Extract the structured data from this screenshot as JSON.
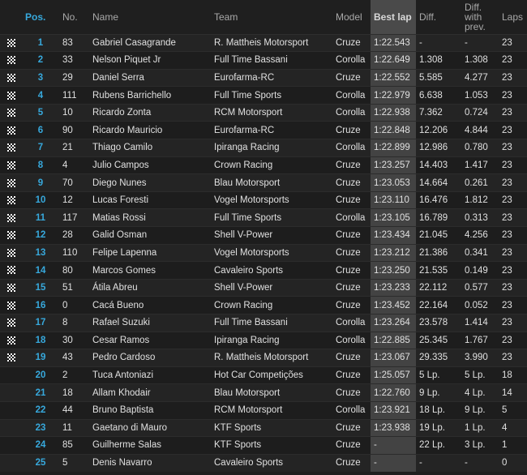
{
  "headers": {
    "pos": "Pos.",
    "no": "No.",
    "name": "Name",
    "team": "Team",
    "model": "Model",
    "best_lap": "Best lap",
    "diff": "Diff.",
    "diff_prev": "Diff. with prev.",
    "laps": "Laps"
  },
  "rows": [
    {
      "finished": true,
      "pos": "1",
      "no": "83",
      "name": "Gabriel Casagrande",
      "team": "R. Mattheis Motorsport",
      "model": "Cruze",
      "best": "1:22.543",
      "diff": "-",
      "prev": "-",
      "laps": "23"
    },
    {
      "finished": true,
      "pos": "2",
      "no": "33",
      "name": "Nelson Piquet Jr",
      "team": "Full Time Bassani",
      "model": "Corolla",
      "best": "1:22.649",
      "diff": "1.308",
      "prev": "1.308",
      "laps": "23"
    },
    {
      "finished": true,
      "pos": "3",
      "no": "29",
      "name": "Daniel Serra",
      "team": "Eurofarma-RC",
      "model": "Cruze",
      "best": "1:22.552",
      "diff": "5.585",
      "prev": "4.277",
      "laps": "23"
    },
    {
      "finished": true,
      "pos": "4",
      "no": "111",
      "name": "Rubens Barrichello",
      "team": "Full Time Sports",
      "model": "Corolla",
      "best": "1:22.979",
      "diff": "6.638",
      "prev": "1.053",
      "laps": "23"
    },
    {
      "finished": true,
      "pos": "5",
      "no": "10",
      "name": "Ricardo Zonta",
      "team": "RCM Motorsport",
      "model": "Corolla",
      "best": "1:22.938",
      "diff": "7.362",
      "prev": "0.724",
      "laps": "23"
    },
    {
      "finished": true,
      "pos": "6",
      "no": "90",
      "name": "Ricardo Mauricio",
      "team": "Eurofarma-RC",
      "model": "Cruze",
      "best": "1:22.848",
      "diff": "12.206",
      "prev": "4.844",
      "laps": "23"
    },
    {
      "finished": true,
      "pos": "7",
      "no": "21",
      "name": "Thiago Camilo",
      "team": "Ipiranga Racing",
      "model": "Corolla",
      "best": "1:22.899",
      "diff": "12.986",
      "prev": "0.780",
      "laps": "23"
    },
    {
      "finished": true,
      "pos": "8",
      "no": "4",
      "name": "Julio Campos",
      "team": "Crown Racing",
      "model": "Cruze",
      "best": "1:23.257",
      "diff": "14.403",
      "prev": "1.417",
      "laps": "23"
    },
    {
      "finished": true,
      "pos": "9",
      "no": "70",
      "name": "Diego Nunes",
      "team": "Blau Motorsport",
      "model": "Cruze",
      "best": "1:23.053",
      "diff": "14.664",
      "prev": "0.261",
      "laps": "23"
    },
    {
      "finished": true,
      "pos": "10",
      "no": "12",
      "name": "Lucas Foresti",
      "team": "Vogel Motorsports",
      "model": "Cruze",
      "best": "1:23.110",
      "diff": "16.476",
      "prev": "1.812",
      "laps": "23"
    },
    {
      "finished": true,
      "pos": "11",
      "no": "117",
      "name": "Matias Rossi",
      "team": "Full Time Sports",
      "model": "Corolla",
      "best": "1:23.105",
      "diff": "16.789",
      "prev": "0.313",
      "laps": "23"
    },
    {
      "finished": true,
      "pos": "12",
      "no": "28",
      "name": "Galid Osman",
      "team": "Shell V-Power",
      "model": "Cruze",
      "best": "1:23.434",
      "diff": "21.045",
      "prev": "4.256",
      "laps": "23"
    },
    {
      "finished": true,
      "pos": "13",
      "no": "110",
      "name": "Felipe Lapenna",
      "team": "Vogel Motorsports",
      "model": "Cruze",
      "best": "1:23.212",
      "diff": "21.386",
      "prev": "0.341",
      "laps": "23"
    },
    {
      "finished": true,
      "pos": "14",
      "no": "80",
      "name": "Marcos Gomes",
      "team": "Cavaleiro Sports",
      "model": "Cruze",
      "best": "1:23.250",
      "diff": "21.535",
      "prev": "0.149",
      "laps": "23"
    },
    {
      "finished": true,
      "pos": "15",
      "no": "51",
      "name": "Átila Abreu",
      "team": "Shell V-Power",
      "model": "Cruze",
      "best": "1:23.233",
      "diff": "22.112",
      "prev": "0.577",
      "laps": "23"
    },
    {
      "finished": true,
      "pos": "16",
      "no": "0",
      "name": "Cacá Bueno",
      "team": "Crown Racing",
      "model": "Cruze",
      "best": "1:23.452",
      "diff": "22.164",
      "prev": "0.052",
      "laps": "23"
    },
    {
      "finished": true,
      "pos": "17",
      "no": "8",
      "name": "Rafael Suzuki",
      "team": "Full Time Bassani",
      "model": "Corolla",
      "best": "1:23.264",
      "diff": "23.578",
      "prev": "1.414",
      "laps": "23"
    },
    {
      "finished": true,
      "pos": "18",
      "no": "30",
      "name": "Cesar Ramos",
      "team": "Ipiranga Racing",
      "model": "Corolla",
      "best": "1:22.885",
      "diff": "25.345",
      "prev": "1.767",
      "laps": "23"
    },
    {
      "finished": true,
      "pos": "19",
      "no": "43",
      "name": "Pedro Cardoso",
      "team": "R. Mattheis Motorsport",
      "model": "Cruze",
      "best": "1:23.067",
      "diff": "29.335",
      "prev": "3.990",
      "laps": "23"
    },
    {
      "finished": false,
      "pos": "20",
      "no": "2",
      "name": "Tuca Antoniazi",
      "team": "Hot Car Competições",
      "model": "Cruze",
      "best": "1:25.057",
      "diff": "5 Lp.",
      "prev": "5 Lp.",
      "laps": "18"
    },
    {
      "finished": false,
      "pos": "21",
      "no": "18",
      "name": "Allam Khodair",
      "team": "Blau Motorsport",
      "model": "Cruze",
      "best": "1:22.760",
      "diff": "9 Lp.",
      "prev": "4 Lp.",
      "laps": "14"
    },
    {
      "finished": false,
      "pos": "22",
      "no": "44",
      "name": "Bruno Baptista",
      "team": "RCM Motorsport",
      "model": "Corolla",
      "best": "1:23.921",
      "diff": "18 Lp.",
      "prev": "9 Lp.",
      "laps": "5"
    },
    {
      "finished": false,
      "pos": "23",
      "no": "11",
      "name": "Gaetano di Mauro",
      "team": "KTF Sports",
      "model": "Cruze",
      "best": "1:23.938",
      "diff": "19 Lp.",
      "prev": "1 Lp.",
      "laps": "4"
    },
    {
      "finished": false,
      "pos": "24",
      "no": "85",
      "name": "Guilherme Salas",
      "team": "KTF Sports",
      "model": "Cruze",
      "best": "-",
      "diff": "22 Lp.",
      "prev": "3 Lp.",
      "laps": "1"
    },
    {
      "finished": false,
      "pos": "25",
      "no": "5",
      "name": "Denis Navarro",
      "team": "Cavaleiro Sports",
      "model": "Cruze",
      "best": "-",
      "diff": "-",
      "prev": "-",
      "laps": "0"
    }
  ]
}
